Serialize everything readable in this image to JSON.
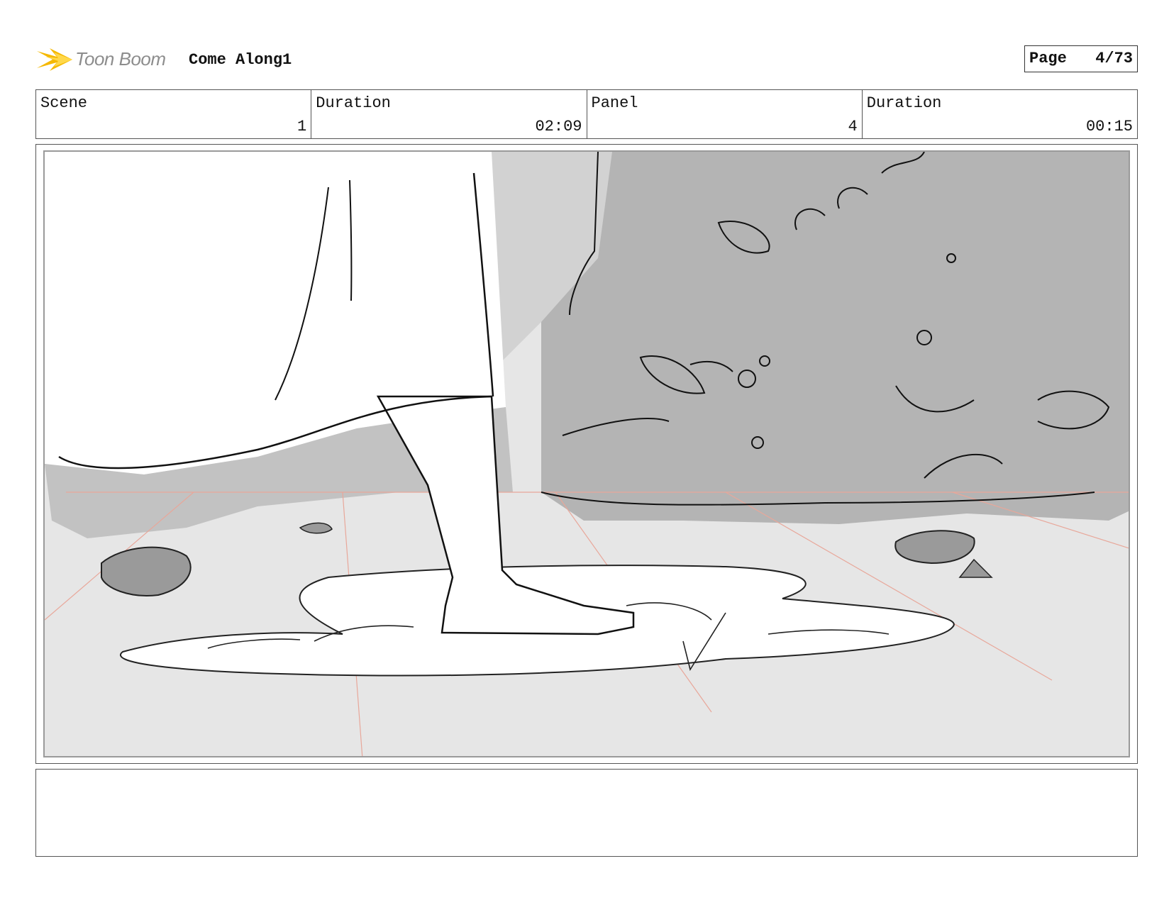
{
  "header": {
    "logo_text": "Toon Boom",
    "project_title": "Come Along1",
    "page_label": "Page",
    "page_number": "4/73"
  },
  "info": {
    "scene_label": "Scene",
    "scene_value": "1",
    "scene_duration_label": "Duration",
    "scene_duration_value": "02:09",
    "panel_label": "Panel",
    "panel_value": "4",
    "panel_duration_label": "Duration",
    "panel_duration_value": "00:15"
  },
  "panel": {
    "icon": "storyboard-sketch-foot-in-puddle"
  },
  "notes": {
    "text": ""
  },
  "colors": {
    "logo_accent": "#f5b800",
    "sketch_line": "#111111",
    "perspective_guide": "#e8a79a",
    "foliage_gray": "#b4b4b4"
  }
}
